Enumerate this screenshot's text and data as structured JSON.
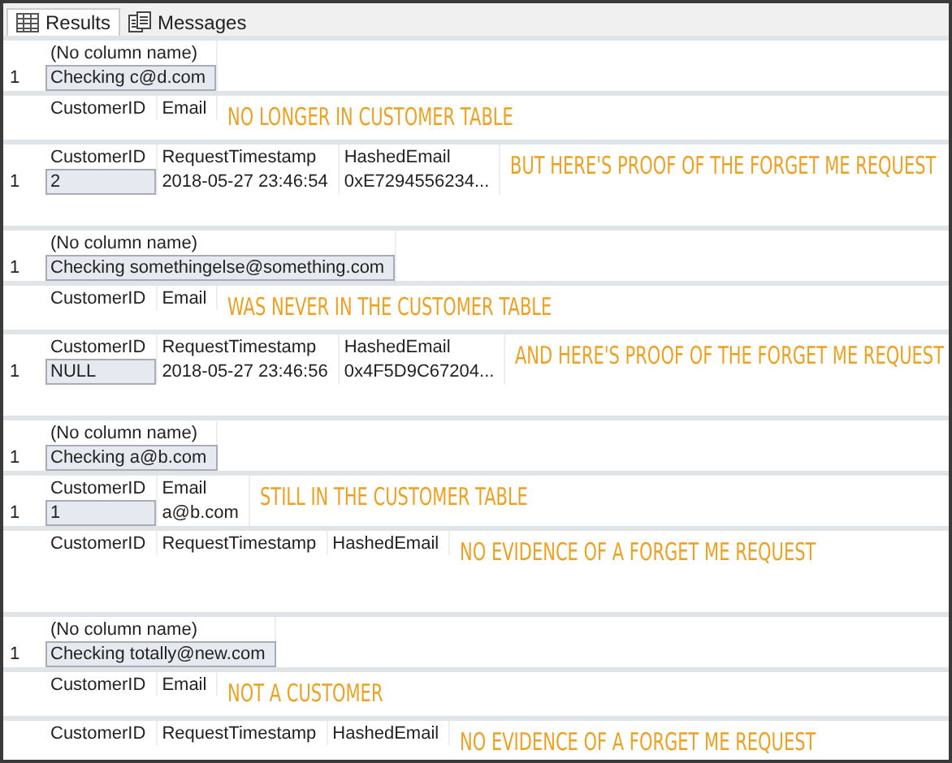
{
  "tabs": [
    {
      "label": "Results",
      "kind": "grid",
      "selected": true
    },
    {
      "label": "Messages",
      "kind": "messages",
      "selected": false
    }
  ],
  "result_sets": [
    {
      "columns": [
        "(No column name)"
      ],
      "rows": [
        {
          "number": "1",
          "cells": [
            {
              "text": "Checking c@d.com",
              "selected": true
            }
          ]
        }
      ]
    },
    {
      "columns": [
        "CustomerID",
        "Email"
      ],
      "annotation": "NO LONGER IN CUSTOMER TABLE"
    },
    {
      "columns": [
        "CustomerID",
        "RequestTimestamp",
        "HashedEmail"
      ],
      "rows": [
        {
          "number": "1",
          "cells": [
            {
              "text": "2",
              "selected": true
            },
            {
              "text": "2018-05-27 23:46:54",
              "selected": false
            },
            {
              "text": "0xE7294556234...",
              "selected": false
            }
          ]
        }
      ],
      "annotation": "BUT HERE'S PROOF OF THE FORGET ME REQUEST"
    },
    {
      "columns": [
        "(No column name)"
      ],
      "rows": [
        {
          "number": "1",
          "cells": [
            {
              "text": "Checking somethingelse@something.com",
              "selected": true
            }
          ]
        }
      ]
    },
    {
      "columns": [
        "CustomerID",
        "Email"
      ],
      "annotation": "WAS NEVER IN THE CUSTOMER TABLE"
    },
    {
      "columns": [
        "CustomerID",
        "RequestTimestamp",
        "HashedEmail"
      ],
      "rows": [
        {
          "number": "1",
          "cells": [
            {
              "text": "NULL",
              "selected": true
            },
            {
              "text": "2018-05-27 23:46:56",
              "selected": false
            },
            {
              "text": "0x4F5D9C67204...",
              "selected": false
            }
          ]
        }
      ],
      "annotation": "AND HERE'S PROOF OF THE FORGET ME REQUEST"
    },
    {
      "columns": [
        "(No column name)"
      ],
      "rows": [
        {
          "number": "1",
          "cells": [
            {
              "text": "Checking a@b.com",
              "selected": true
            }
          ]
        }
      ]
    },
    {
      "columns": [
        "CustomerID",
        "Email"
      ],
      "rows": [
        {
          "number": "1",
          "cells": [
            {
              "text": "1",
              "selected": true
            },
            {
              "text": "a@b.com",
              "selected": false
            }
          ]
        }
      ],
      "annotation": "STILL IN THE CUSTOMER TABLE"
    },
    {
      "columns": [
        "CustomerID",
        "RequestTimestamp",
        "HashedEmail"
      ],
      "annotation": "NO EVIDENCE OF A FORGET ME REQUEST"
    },
    {
      "columns": [
        "(No column name)"
      ],
      "rows": [
        {
          "number": "1",
          "cells": [
            {
              "text": "Checking totally@new.com",
              "selected": true
            }
          ]
        }
      ]
    },
    {
      "columns": [
        "CustomerID",
        "Email"
      ],
      "annotation": "NOT A CUSTOMER"
    },
    {
      "columns": [
        "CustomerID",
        "RequestTimestamp",
        "HashedEmail"
      ],
      "annotation": "NO EVIDENCE OF A FORGET ME REQUEST"
    }
  ]
}
